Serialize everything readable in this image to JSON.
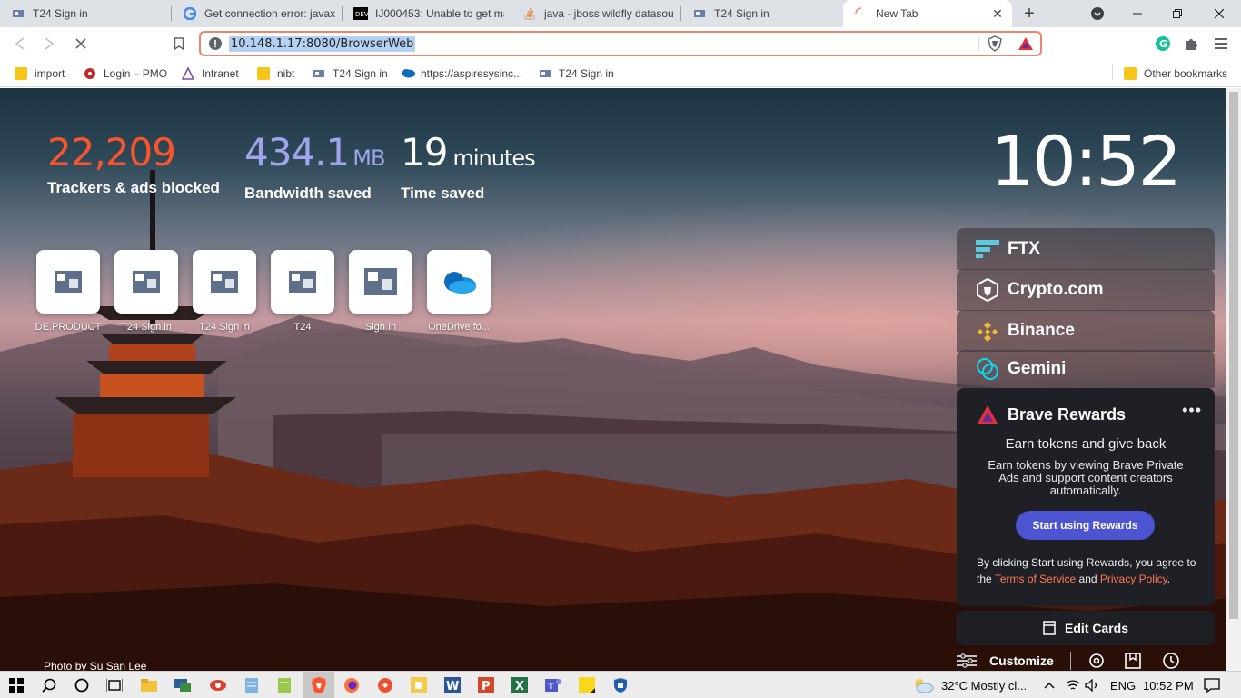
{
  "browser": {
    "tabs": [
      {
        "title": "T24 Sign in",
        "icon": "t24-icon"
      },
      {
        "title": "Get connection error: javax.",
        "icon": "google-icon"
      },
      {
        "title": "IJ000453: Unable to get mar",
        "icon": "dev-icon"
      },
      {
        "title": "java - jboss wildfly datasour",
        "icon": "stackoverflow-icon"
      },
      {
        "title": "T24 Sign in",
        "icon": "t24-icon"
      },
      {
        "title": "New Tab",
        "icon": "loading-icon"
      }
    ],
    "window_controls": [
      "minimize",
      "restore",
      "close"
    ],
    "url": "10.148.1.17:8080/BrowserWeb",
    "bookmarks": [
      {
        "label": "import",
        "icon": "folder-icon"
      },
      {
        "label": "Login – PMO",
        "icon": "pmo-icon"
      },
      {
        "label": "Intranet",
        "icon": "intranet-icon"
      },
      {
        "label": "nibt",
        "icon": "folder-icon"
      },
      {
        "label": "T24 Sign in",
        "icon": "t24-icon"
      },
      {
        "label": "https://aspiresysinc...",
        "icon": "onedrive-icon"
      },
      {
        "label": "T24 Sign in",
        "icon": "t24-icon"
      }
    ],
    "other_bookmarks": "Other bookmarks"
  },
  "ntp": {
    "stats": {
      "trackers_value": "22,209",
      "trackers_label": "Trackers & ads blocked",
      "bandwidth_value": "434.1",
      "bandwidth_unit": "MB",
      "bandwidth_label": "Bandwidth saved",
      "time_value": "19",
      "time_unit": "minutes",
      "time_label": "Time saved"
    },
    "clock": "10:52",
    "top_sites": [
      {
        "label": "DE.PRODUCT",
        "icon": "t24-globe-icon"
      },
      {
        "label": "T24 Sign in",
        "icon": "t24-globe-icon"
      },
      {
        "label": "T24 Sign in",
        "icon": "t24-globe-icon"
      },
      {
        "label": "T24",
        "icon": "t24-globe-icon"
      },
      {
        "label": "Sign In",
        "icon": "t24-globe-icon"
      },
      {
        "label": "OneDrive fo...",
        "icon": "onedrive-icon"
      }
    ],
    "crypto_cards": [
      {
        "label": "FTX",
        "icon": "ftx-icon"
      },
      {
        "label": "Crypto.com",
        "icon": "cryptocom-icon"
      },
      {
        "label": "Binance",
        "icon": "binance-icon"
      },
      {
        "label": "Gemini",
        "icon": "gemini-icon"
      }
    ],
    "rewards": {
      "title": "Brave Rewards",
      "subtitle": "Earn tokens and give back",
      "description": "Earn tokens by viewing Brave Private Ads and support content creators automatically.",
      "cta": "Start using Rewards",
      "terms_prefix": "By clicking Start using Rewards, you agree to the",
      "terms_link": "Terms of Service",
      "terms_and": "and",
      "privacy_link": "Privacy Policy",
      "terms_suffix": "."
    },
    "edit_cards": "Edit Cards",
    "customize": "Customize",
    "photo_credit_prefix": "Photo by",
    "photo_credit_author": "Su San Lee"
  },
  "taskbar": {
    "weather": "32°C  Mostly cl...",
    "language": "ENG",
    "time": "10:52 PM"
  },
  "colors": {
    "trackers": "#fb542b",
    "bandwidth": "#a0a5eb",
    "accent_button": "#4c54d2",
    "link": "#ff7654"
  }
}
